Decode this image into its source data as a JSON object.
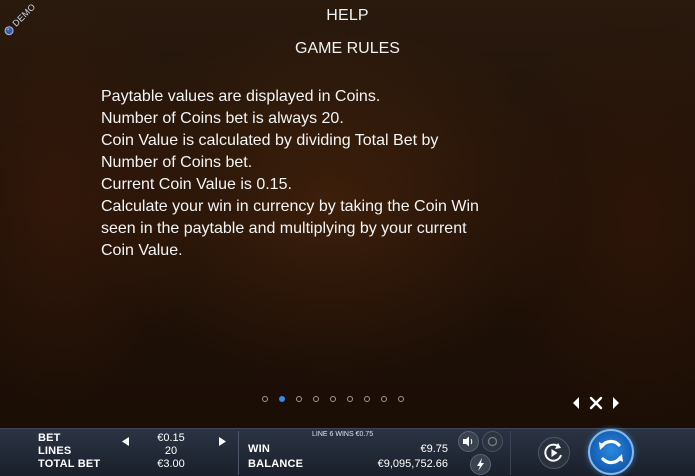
{
  "badge": {
    "text": "DEMO"
  },
  "header": {
    "title": "HELP",
    "subtitle": "GAME RULES"
  },
  "rules": [
    "Paytable values are displayed in Coins.",
    "Number of Coins bet is always 20.",
    "Coin Value is calculated by dividing Total Bet by",
    "Number of Coins bet.",
    "Current Coin Value is 0.15.",
    "Calculate your win in currency by taking the Coin Win",
    "seen in the paytable and multiplying by your current",
    "Coin Value."
  ],
  "pagination": {
    "total": 9,
    "active_index": 1
  },
  "bottom_bar": {
    "bet_label": "BET",
    "bet_value": "€0.15",
    "lines_label": "LINES",
    "lines_value": "20",
    "total_bet_label": "TOTAL BET",
    "total_bet_value": "€3.00",
    "line_win_message": "LINE 6 WINS €0.75",
    "win_label": "WIN",
    "win_value": "€9.75",
    "balance_label": "BALANCE",
    "balance_value": "€9,095,752.66"
  },
  "icons": [
    "close-icon",
    "arrow-left-icon",
    "arrow-right-icon",
    "speaker-icon",
    "lightning-icon",
    "autoplay-icon",
    "spin-icon"
  ],
  "colors": {
    "accent": "#3a88e8",
    "bar": "#1f2633"
  }
}
